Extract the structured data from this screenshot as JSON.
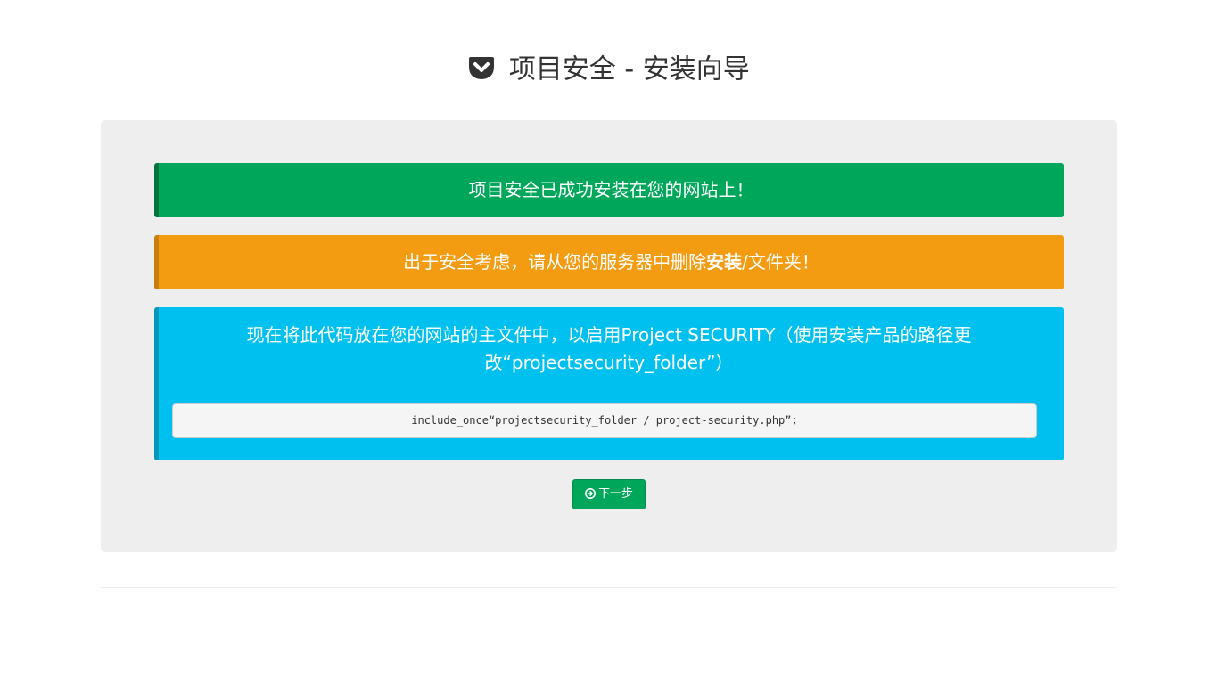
{
  "header": {
    "title": "项目安全 - 安装向导",
    "logo_icon": "pocket-shield-icon"
  },
  "alerts": {
    "success_text": "项目安全已成功安装在您的网站上！",
    "warning_text_before": "出于安全考虑，请从您的服务器中删除",
    "warning_text_bold": "安装",
    "warning_text_after": "/文件夹！",
    "info_text": "现在将此代码放在您的网站的主文件中，以启用Project SECURITY（使用安装产品的路径更改“projectsecurity_folder”）",
    "code": "include_once“projectsecurity_folder / project-security.php”;"
  },
  "actions": {
    "next_label": "下一步",
    "next_icon": "arrow-circle-right-icon"
  },
  "colors": {
    "success": "#00a65a",
    "warning": "#f39c12",
    "info": "#00c0ef"
  }
}
